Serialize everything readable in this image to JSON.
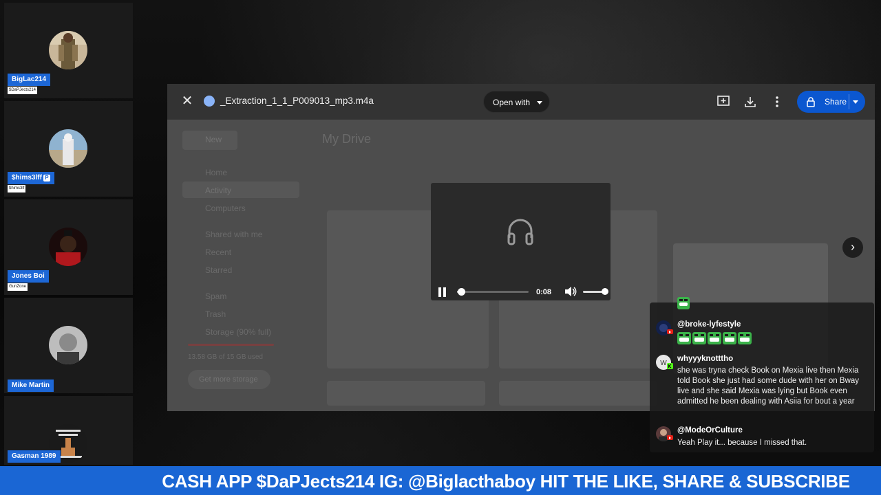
{
  "participants": [
    {
      "name": "BigLac214",
      "subtitle": "$DaPJects214",
      "badge": ""
    },
    {
      "name": "$hims3lff",
      "subtitle": "$hims3lf",
      "badge": "P"
    },
    {
      "name": "Jones Boi",
      "subtitle": "GunZone",
      "badge": ""
    },
    {
      "name": "Mike Martin",
      "subtitle": "",
      "badge": ""
    },
    {
      "name": "Gasman 1989",
      "subtitle": "",
      "badge": ""
    }
  ],
  "drive": {
    "file_name": "_Extraction_1_1_P009013_mp3.m4a",
    "open_with_label": "Open with",
    "share_label": "Share",
    "background_title": "My Drive",
    "background_nav": [
      "New",
      "Home",
      "Activity",
      "Computers",
      "Shared with me",
      "Recent",
      "Starred",
      "Spam",
      "Trash",
      "Storage (90% full)"
    ],
    "background_storage": "13.58 GB of 15 GB used",
    "background_button": "Get more storage"
  },
  "player": {
    "time": "0:08",
    "progress_fraction": 0.06,
    "volume_fraction": 0.9
  },
  "chat": {
    "messages": [
      {
        "user": "@broke-lyfestyle",
        "text": "",
        "emote_count": 5,
        "platform": "youtube"
      },
      {
        "user": "whyyyknotttho",
        "text": "she was tryna check Book on Mexia live then Mexia told Book she just had some dude with her on Bway live and she said Mexia was lying but Book even admitted he been dealing with Asiia for bout a year",
        "emote_count": 0,
        "platform": "kick"
      },
      {
        "user": "@ModeOrCulture",
        "text": "Yeah Play it... because I missed that.",
        "emote_count": 0,
        "platform": "youtube"
      }
    ]
  },
  "banner": {
    "text": "CASH APP $DaPJects214 IG: @Biglacthaboy HIT THE LIKE, SHARE & SUBSCRIBE"
  },
  "colors": {
    "banner_blue": "#1a66d4",
    "name_tag_blue": "#1d67d6",
    "share_blue": "#0b57d0",
    "emote_green": "#3bb34a"
  }
}
